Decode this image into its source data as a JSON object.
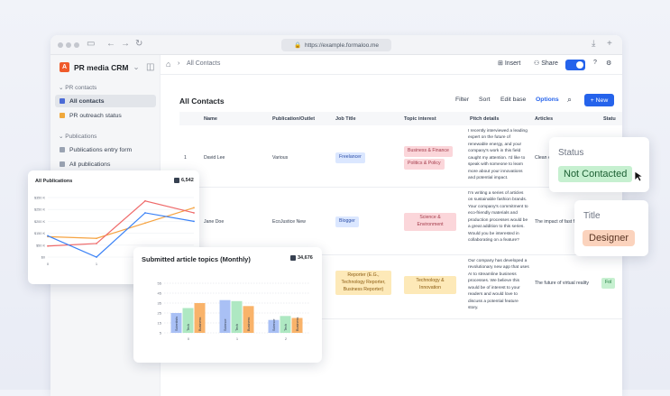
{
  "browser": {
    "url": "https://example.formaloo.me"
  },
  "app": {
    "name": "PR media CRM"
  },
  "breadcrumb": {
    "current": "All Contacts"
  },
  "toolbar": {
    "insert": "Insert",
    "share": "Share"
  },
  "sidebar": {
    "section1": "PR contacts",
    "items1": [
      "All contacts",
      "PR outreach status"
    ],
    "section2": "Publications",
    "items2": [
      "Publications entry form",
      "All publications"
    ]
  },
  "view": {
    "title": "All Contacts",
    "filter": "Filter",
    "sort": "Sort",
    "edit_base": "Edit base",
    "options": "Options",
    "new": "New"
  },
  "table": {
    "headers": [
      "Name",
      "Publication/Outlet",
      "Job Title",
      "Topic interest",
      "Pitch details",
      "Articles",
      "Statu"
    ],
    "rows": [
      {
        "num": "1",
        "name": "David Lee",
        "outlet": "Various",
        "job": "Freelancer",
        "topics": [
          "Business & Finance",
          "Politics & Policy"
        ],
        "pitch": "I recently interviewed a leading expert on the future of renewable energy, and your company's work in this field caught my attention. I'd like to speak with someone to learn more about your innovations and potential impact.",
        "article": "Clean e",
        "status": ""
      },
      {
        "num": "",
        "name": "Jane Doe",
        "outlet": "EcoJustice New",
        "job": "Blogger",
        "topics": [
          "Science & Environment"
        ],
        "pitch": "I'm writing a series of articles on sustainable fashion brands. Your company's commitment to eco-friendly materials and production processes would be a great addition to this series. Would you be interested in collaborating on a feature?",
        "article": "The impact of fast fa",
        "status": ""
      },
      {
        "num": "",
        "name": "",
        "outlet": "",
        "job": "Reporter (E.G., Technology Reporter, Business Reporter)",
        "topics": [
          "Technology & Innovation"
        ],
        "pitch": "Our company has developed a revolutionary new app that uses AI to streamline business processes. We believe this would be of interest to your readers and would love to discuss a potential feature story.",
        "article": "The future of virtual reality",
        "status": "Fol"
      }
    ]
  },
  "status_card": {
    "label": "Status",
    "value": "Not Contacted"
  },
  "title_card": {
    "label": "Title",
    "value": "Designer"
  },
  "colors": {
    "accent": "#2563eb",
    "brand": "#ef5a2a",
    "green_chip": "#c6f0d0",
    "orange_chip": "#fbd3bd"
  },
  "chart_publications": {
    "title": "All Publications",
    "badge": "6,542"
  },
  "chart_topics": {
    "title": "Submitted article topics (Monthly)",
    "badge": "34,676"
  },
  "chart_data": [
    {
      "type": "line",
      "title": "All Publications",
      "x": [
        "0",
        "1",
        "2",
        "3"
      ],
      "ytick_labels": [
        "$350 K",
        "$250 K",
        "$200 K",
        "$150 K",
        "$50 K",
        "$0"
      ],
      "xtick_labels": [
        "0",
        "1"
      ],
      "series": [
        {
          "color": "#f6a341",
          "values": [
            120,
            110,
            200,
            290
          ]
        },
        {
          "color": "#ef6a6a",
          "values": [
            65,
            80,
            330,
            260
          ]
        },
        {
          "color": "#3b82f6",
          "values": [
            125,
            0,
            260,
            210
          ]
        }
      ],
      "ylim": [
        0,
        350
      ]
    },
    {
      "type": "bar",
      "title": "Submitted article topics (Monthly)",
      "categories": [
        "0",
        "1",
        "2"
      ],
      "ytick_labels": [
        "55",
        "45",
        "35",
        "25",
        "15",
        "5"
      ],
      "ylim": [
        5,
        55
      ],
      "series": [
        {
          "name": "Scientists",
          "color": "#a9c0f5",
          "values": [
            25,
            38,
            18
          ]
        },
        {
          "name": "Tech",
          "color": "#aee8c2",
          "values": [
            30,
            37,
            22
          ]
        },
        {
          "name": "Business",
          "color": "#f9b36a",
          "values": [
            35,
            32,
            20
          ]
        }
      ],
      "bar_labels": [
        [
          "Scientists",
          "Tech",
          "Business"
        ],
        [
          "Science",
          "Tech",
          "Business"
        ],
        [
          "Science",
          "Tech",
          "Business"
        ]
      ]
    }
  ]
}
